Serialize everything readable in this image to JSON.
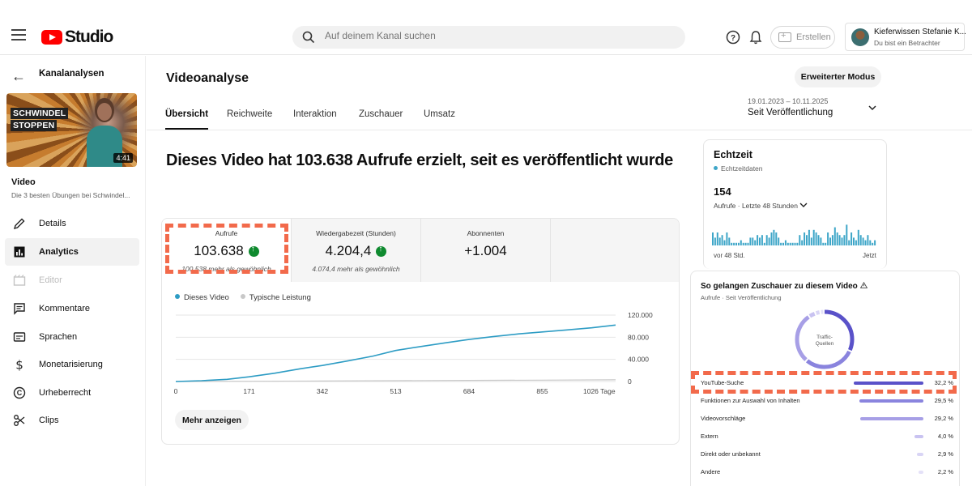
{
  "header": {
    "logo_text": "Studio",
    "search_placeholder": "Auf deinem Kanal suchen",
    "create_label": "Erstellen",
    "account_name": "Kieferwissen Stefanie K...",
    "account_role": "Du bist ein Betrachter"
  },
  "sidebar": {
    "back_label": "Kanalanalysen",
    "thumbnail": {
      "line1": "SCHWINDEL",
      "line2": "STOPPEN",
      "duration": "4:41"
    },
    "video_heading": "Video",
    "video_title": "Die 3 besten Übungen bei Schwindel...",
    "items": [
      {
        "label": "Details",
        "icon": "pencil-icon"
      },
      {
        "label": "Analytics",
        "icon": "analytics-icon",
        "active": true
      },
      {
        "label": "Editor",
        "icon": "editor-icon",
        "disabled": true
      },
      {
        "label": "Kommentare",
        "icon": "comments-icon"
      },
      {
        "label": "Sprachen",
        "icon": "subtitles-icon"
      },
      {
        "label": "Monetarisierung",
        "icon": "dollar-icon"
      },
      {
        "label": "Urheberrecht",
        "icon": "copyright-icon"
      },
      {
        "label": "Clips",
        "icon": "scissors-icon"
      }
    ]
  },
  "main": {
    "title": "Videoanalyse",
    "advanced_button": "Erweiterter Modus",
    "tabs": [
      "Übersicht",
      "Reichweite",
      "Interaktion",
      "Zuschauer",
      "Umsatz"
    ],
    "active_tab": "Übersicht",
    "date_range": {
      "dates": "19.01.2023 – 10.11.2025",
      "label": "Seit Veröffentlichung"
    },
    "headline": "Dieses Video hat 103.638 Aufrufe erzielt, seit es veröffentlicht wurde",
    "metrics": [
      {
        "title": "Aufrufe",
        "value": "103.638",
        "trend": "up",
        "sub": "100.538 mehr als gewöhnlich"
      },
      {
        "title": "Wiedergabezeit (Stunden)",
        "value": "4.204,4",
        "trend": "up",
        "sub": "4.074,4 mehr als gewöhnlich"
      },
      {
        "title": "Abonnenten",
        "value": "+1.004",
        "sub": ""
      }
    ],
    "more_button": "Mehr anzeigen"
  },
  "chart_data": {
    "type": "line",
    "legend": [
      "Dieses Video",
      "Typische Leistung"
    ],
    "x_ticks": [
      "0",
      "171",
      "342",
      "513",
      "684",
      "855",
      "1026 Tage"
    ],
    "y_ticks": [
      "0",
      "40.000",
      "80.000",
      "120.000"
    ],
    "ylim": [
      0,
      120000
    ],
    "xlim": [
      0,
      1026
    ],
    "series": [
      {
        "name": "Dieses Video",
        "color": "#2d9cc4",
        "x": [
          0,
          60,
          120,
          171,
          230,
          290,
          342,
          400,
          460,
          513,
          570,
          630,
          684,
          740,
          800,
          855,
          910,
          970,
          1026
        ],
        "y": [
          0,
          1500,
          4000,
          8500,
          15000,
          23000,
          29000,
          37000,
          46000,
          56000,
          63000,
          70000,
          76000,
          81000,
          86000,
          89500,
          93000,
          97000,
          102000
        ]
      },
      {
        "name": "Typische Leistung",
        "color": "#c8c8c8",
        "x": [
          0,
          171,
          342,
          513,
          684,
          855,
          1026
        ],
        "y": [
          0,
          400,
          900,
          1500,
          2000,
          2500,
          3100
        ]
      }
    ]
  },
  "realtime": {
    "title": "Echtzeit",
    "subtitle": "Echtzeitdaten",
    "value": "154",
    "description": "Aufrufe · Letzte 48 Stunden",
    "start_label": "vor 48 Std.",
    "end_label": "Jetzt",
    "bars": [
      5,
      3,
      5,
      3,
      4,
      2,
      5,
      3,
      1,
      1,
      1,
      1,
      2,
      1,
      1,
      1,
      3,
      3,
      2,
      4,
      3,
      4,
      1,
      4,
      3,
      5,
      6,
      5,
      3,
      1,
      1,
      2,
      1,
      1,
      1,
      1,
      1,
      4,
      2,
      5,
      4,
      6,
      3,
      6,
      5,
      4,
      3,
      1,
      1,
      5,
      3,
      4,
      7,
      5,
      4,
      3,
      4,
      8,
      2,
      5,
      3,
      2,
      6,
      4,
      3,
      2,
      4,
      2,
      1,
      2
    ]
  },
  "traffic": {
    "title": "So gelangen Zuschauer zu diesem Video",
    "subtitle": "Aufrufe · Seit Veröffentlichung",
    "donut_label_1": "Traffic-",
    "donut_label_2": "Quellen",
    "rows": [
      {
        "name": "YouTube-Suche",
        "pct": "32,2 %",
        "value": 32.2,
        "color": "#5a52c9"
      },
      {
        "name": "Funktionen zur Auswahl von Inhalten",
        "pct": "29,5 %",
        "value": 29.5,
        "color": "#8a84de"
      },
      {
        "name": "Videovorschläge",
        "pct": "29,2 %",
        "value": 29.2,
        "color": "#a79fe6"
      },
      {
        "name": "Extern",
        "pct": "4,0 %",
        "value": 4.0,
        "color": "#c9c3f1"
      },
      {
        "name": "Direkt oder unbekannt",
        "pct": "2,9 %",
        "value": 2.9,
        "color": "#d9d5f5"
      },
      {
        "name": "Andere",
        "pct": "2,2 %",
        "value": 2.2,
        "color": "#e4e1f8"
      }
    ]
  },
  "colors": {
    "accent": "#2d9cc4",
    "highlight": "#f26a4b",
    "brand": "#ff0000",
    "up": "#0f8a2f"
  }
}
